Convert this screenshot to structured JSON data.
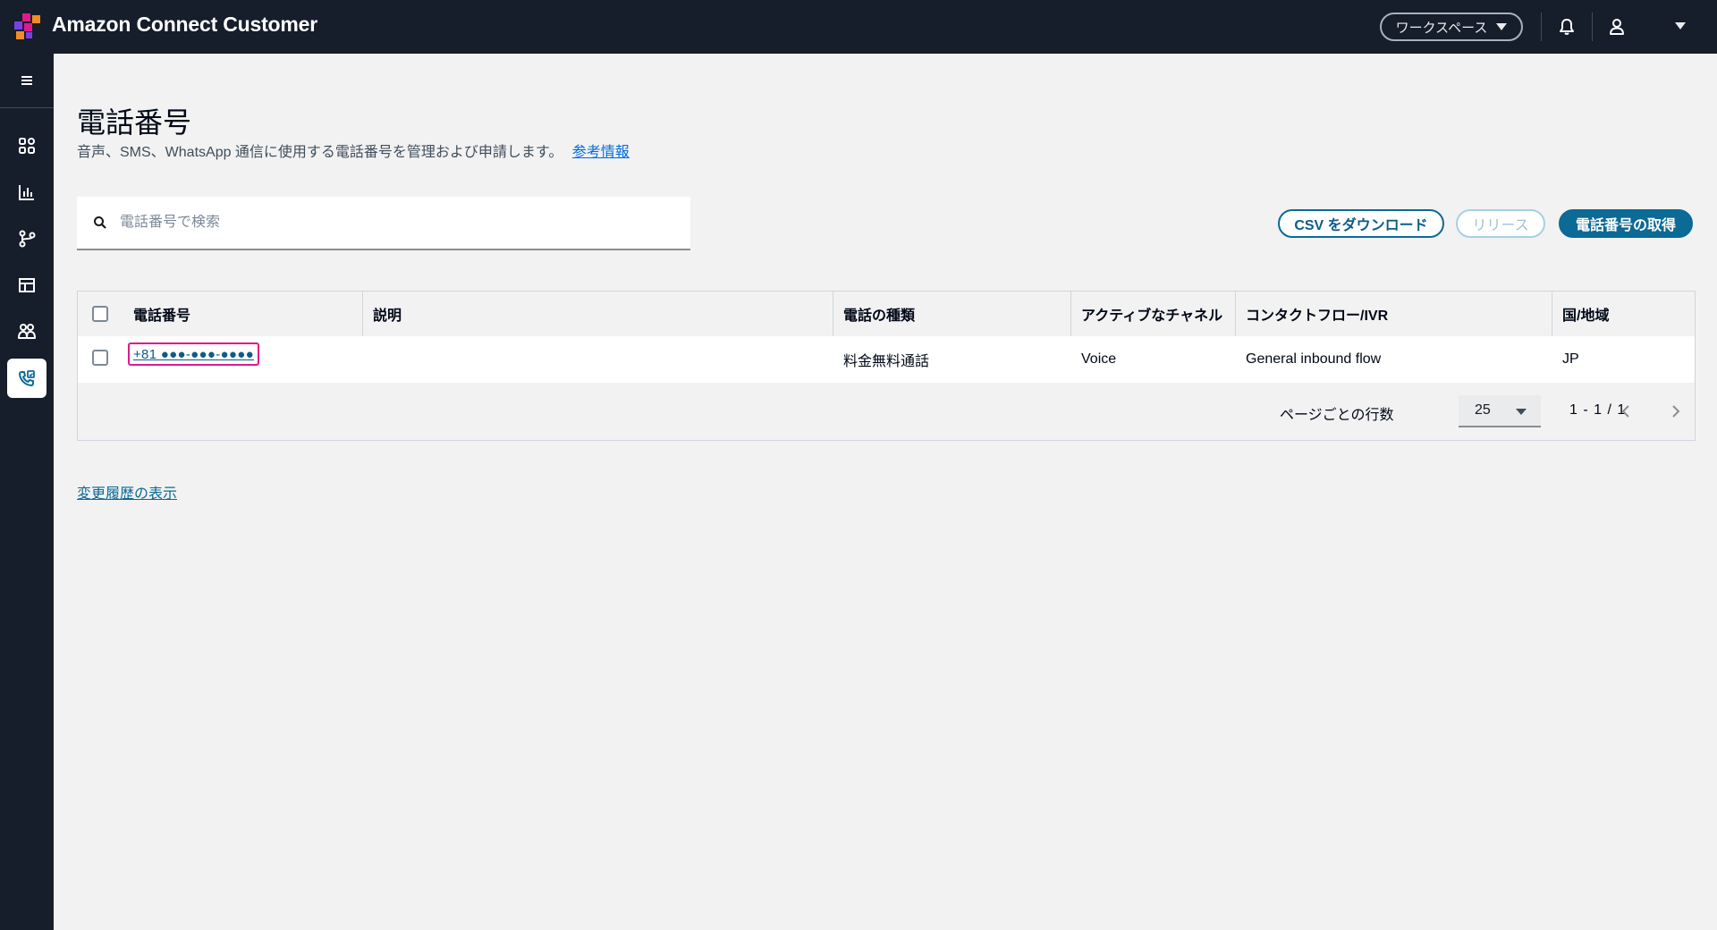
{
  "app": {
    "title": "Amazon Connect Customer",
    "workspace_label": "ワークスペース"
  },
  "sidebar": {
    "items": [
      {
        "icon": "menu-icon",
        "active": false
      },
      {
        "icon": "dashboard-icon",
        "active": false
      },
      {
        "icon": "analytics-icon",
        "active": false
      },
      {
        "icon": "routing-icon",
        "active": false
      },
      {
        "icon": "channels-icon",
        "active": false
      },
      {
        "icon": "users-icon",
        "active": false
      },
      {
        "icon": "phone-settings-icon",
        "active": true
      }
    ]
  },
  "page": {
    "title": "電話番号",
    "description": "音声、SMS、WhatsApp 通信に使用する電話番号を管理および申請します。",
    "info_link": "参考情報"
  },
  "search": {
    "placeholder": "電話番号で検索",
    "value": ""
  },
  "actions": {
    "download_csv": "CSV をダウンロード",
    "release": "リリース",
    "acquire": "電話番号の取得"
  },
  "table": {
    "columns": [
      "電話番号",
      "説明",
      "電話の種類",
      "アクティブなチャネル",
      "コンタクトフロー/IVR",
      "国/地域"
    ],
    "rows": [
      {
        "phone": "+81 ●●●-●●●-●●●●",
        "description": "",
        "type": "料金無料通話",
        "channel": "Voice",
        "flow": "General inbound flow",
        "country": "JP"
      }
    ]
  },
  "pagination": {
    "rows_per_page_label": "ページごとの行数",
    "rows_per_page": "25",
    "range": "1 - 1 / 1"
  },
  "history_link": "変更履歴の表示",
  "colors": {
    "topbar": "#161d2b",
    "accent": "#0b6a96",
    "highlight": "#e0198a"
  }
}
